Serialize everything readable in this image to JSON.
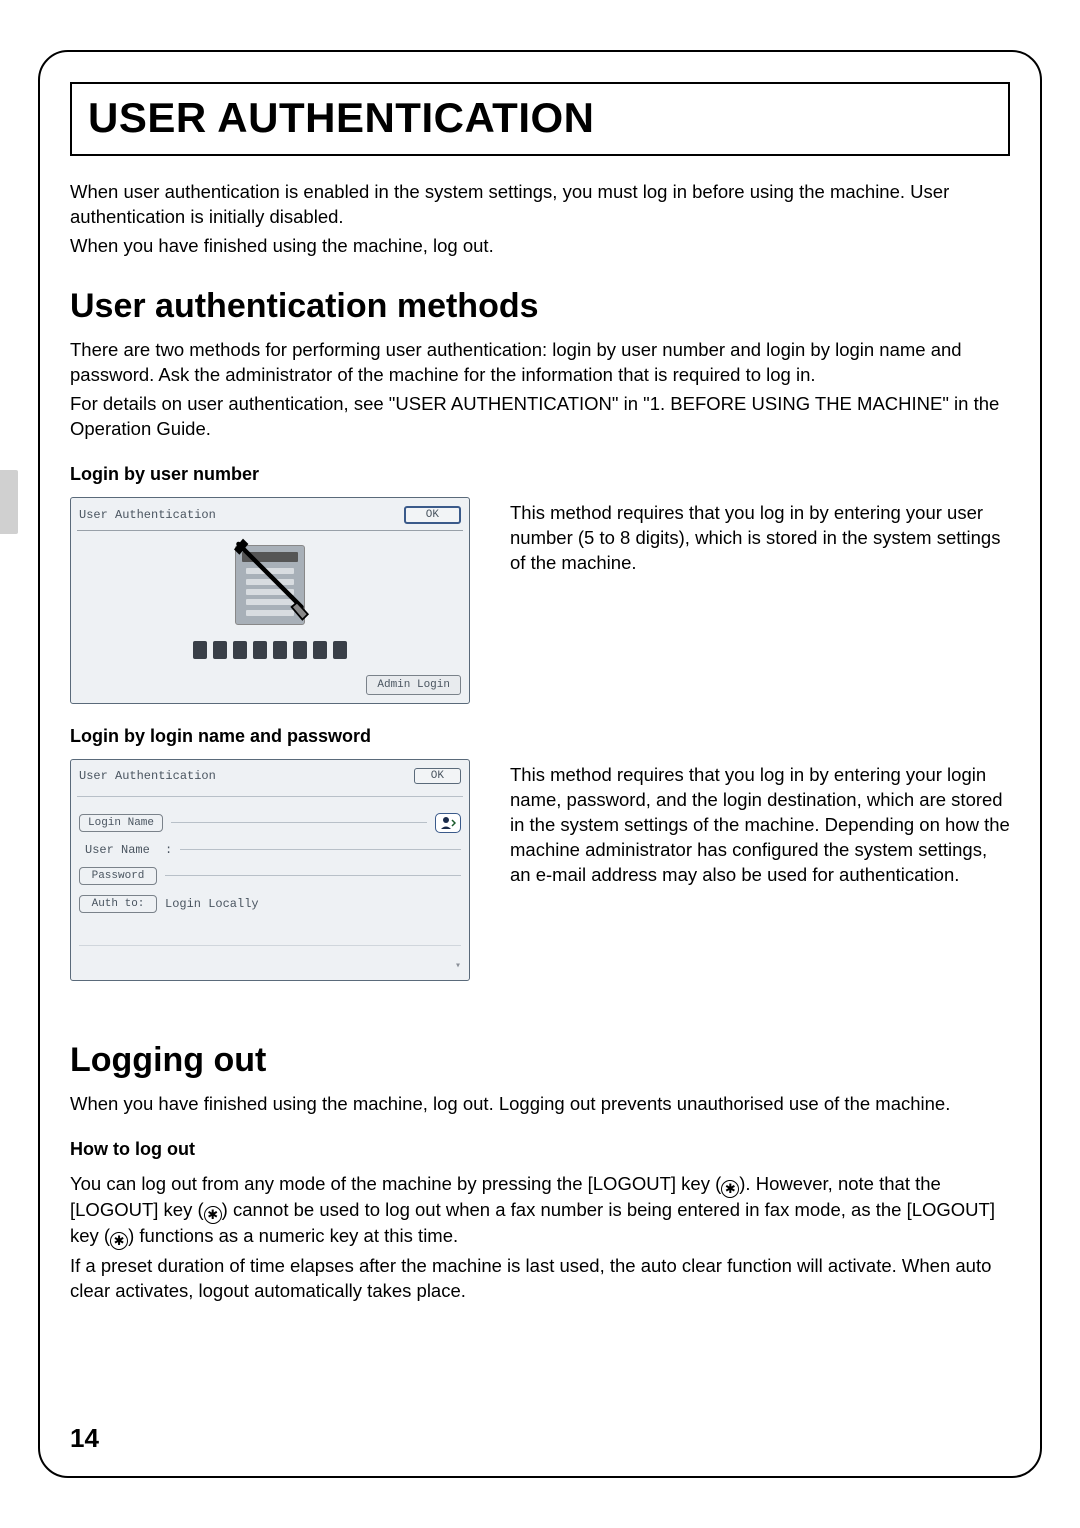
{
  "title": "USER AUTHENTICATION",
  "intro_line1": "When user authentication is enabled in the system settings, you must log in before using the machine. User authentication is initially disabled.",
  "intro_line2": "When you have finished using the machine, log out.",
  "methods": {
    "heading": "User authentication methods",
    "para": "There are two methods for performing user authentication: login by user number and login by login name and password. Ask the administrator of the machine for the information that is required to log in.",
    "para2": "For details on user authentication, see \"USER AUTHENTICATION\" in \"1. BEFORE USING THE MACHINE\" in the Operation Guide.",
    "by_number": {
      "subhead": "Login by user number",
      "desc": "This method requires that you log in by entering your user number (5 to 8 digits), which is stored in the system settings of the machine.",
      "panel_title": "User Authentication",
      "ok": "OK",
      "admin_login": "Admin Login"
    },
    "by_login": {
      "subhead": "Login by login name and password",
      "desc": "This method requires that you log in by entering your login name, password, and the login destination, which are stored in the system settings of the machine. Depending on how the machine administrator has configured the system settings, an e-mail address may also be used for authentication.",
      "panel_title": "User Authentication",
      "ok": "OK",
      "login_name": "Login Name",
      "user_name_label": "User Name",
      "user_name_sep": ":",
      "password": "Password",
      "auth_to": "Auth to:",
      "auth_value": "Login Locally"
    }
  },
  "logout": {
    "heading": "Logging out",
    "para": "When you have finished using the machine, log out. Logging out prevents unauthorised use of the machine.",
    "subhead": "How to log out",
    "body1a": "You can log out from any mode of the machine by pressing the [LOGOUT] key (",
    "body1b": "). However, note that the [LOGOUT] key (",
    "body1c": ") cannot be used to log out when a fax number is being entered in fax mode, as the [LOGOUT] key (",
    "body1d": ") functions as a numeric key at this time.",
    "body2": "If a preset duration of time elapses after the machine is last used, the auto clear function will activate. When auto clear activates, logout automatically takes place."
  },
  "asterisk": "✱",
  "page_number": "14"
}
